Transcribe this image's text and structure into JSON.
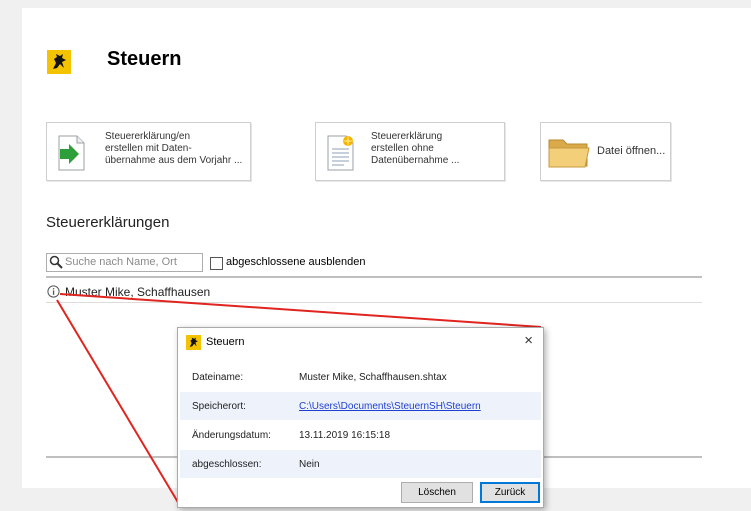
{
  "app": {
    "title": "Steuern"
  },
  "actions": [
    {
      "label": "Steuererklärung/en\nerstellen mit Daten-\nübernahme aus dem Vorjahr ...",
      "icon": "document-arrow-icon"
    },
    {
      "label": "Steuererklärung\nerstellen ohne\nDatenübernahme ...",
      "icon": "new-document-icon"
    },
    {
      "label": "Datei öffnen...",
      "icon": "folder-icon"
    }
  ],
  "list": {
    "title": "Steuererklärungen",
    "search_placeholder": "Suche nach Name, Ort",
    "hide_completed_label": "abgeschlossene ausblenden",
    "hide_completed_checked": false,
    "rows": [
      {
        "label": "Muster Mike, Schaffhausen"
      }
    ]
  },
  "dialog": {
    "title": "Steuern",
    "close": "×",
    "fields": [
      {
        "key": "Dateiname:",
        "value": "Muster Mike, Schaffhausen.shtax"
      },
      {
        "key": "Speicherort:",
        "value": "C:\\Users\\Documents\\SteuernSH\\Steuern"
      },
      {
        "key": "Änderungsdatum:",
        "value": "13.11.2019 16:15:18"
      },
      {
        "key": "abgeschlossen:",
        "value": "Nein"
      }
    ],
    "delete_label": "Löschen",
    "back_label": "Zurück"
  },
  "colors": {
    "annotation": "#e0241f",
    "link": "#1f3fd1",
    "logo_yellow": "#f4c300"
  }
}
